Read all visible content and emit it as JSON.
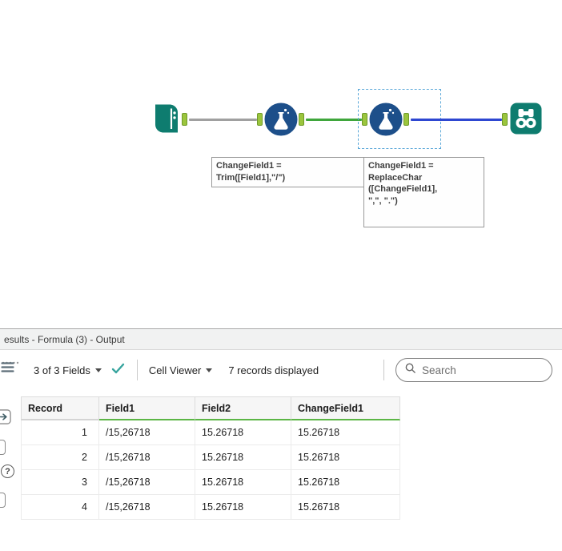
{
  "colors": {
    "tool_teal": "#0e7c6f",
    "formula_blue": "#1d4f8a",
    "anchor_green": "#9bc53d",
    "anchor_border": "#6f9a2a",
    "wire_gray": "#a0a0a0",
    "wire_green": "#3fa63c",
    "wire_blue": "#2e47d1",
    "selection_blue": "#58a6d8",
    "header_underline_green": "#5cb646",
    "check_teal": "#36a49e"
  },
  "canvas": {
    "annotation_formula1": {
      "lines": [
        "ChangeField1 =",
        "Trim([Field1],\"/\")"
      ]
    },
    "annotation_formula2": {
      "lines": [
        "ChangeField1 =",
        "ReplaceChar",
        "([ChangeField1],",
        "\",\", \".\")"
      ]
    }
  },
  "results": {
    "title": "esults - Formula (3) - Output",
    "toolbar": {
      "fields_label": "3 of 3 Fields",
      "cell_viewer_label": "Cell Viewer",
      "records_label": "7 records displayed",
      "search_placeholder": "Search"
    },
    "sidebar": {
      "help_glyph": "?"
    },
    "table": {
      "columns": [
        "Record",
        "Field1",
        "Field2",
        "ChangeField1"
      ],
      "rows": [
        [
          "1",
          "/15,26718",
          "15.26718",
          "15.26718"
        ],
        [
          "2",
          "/15,26718",
          "15.26718",
          "15.26718"
        ],
        [
          "3",
          "/15,26718",
          "15.26718",
          "15.26718"
        ],
        [
          "4",
          "/15,26718",
          "15.26718",
          "15.26718"
        ]
      ]
    }
  }
}
